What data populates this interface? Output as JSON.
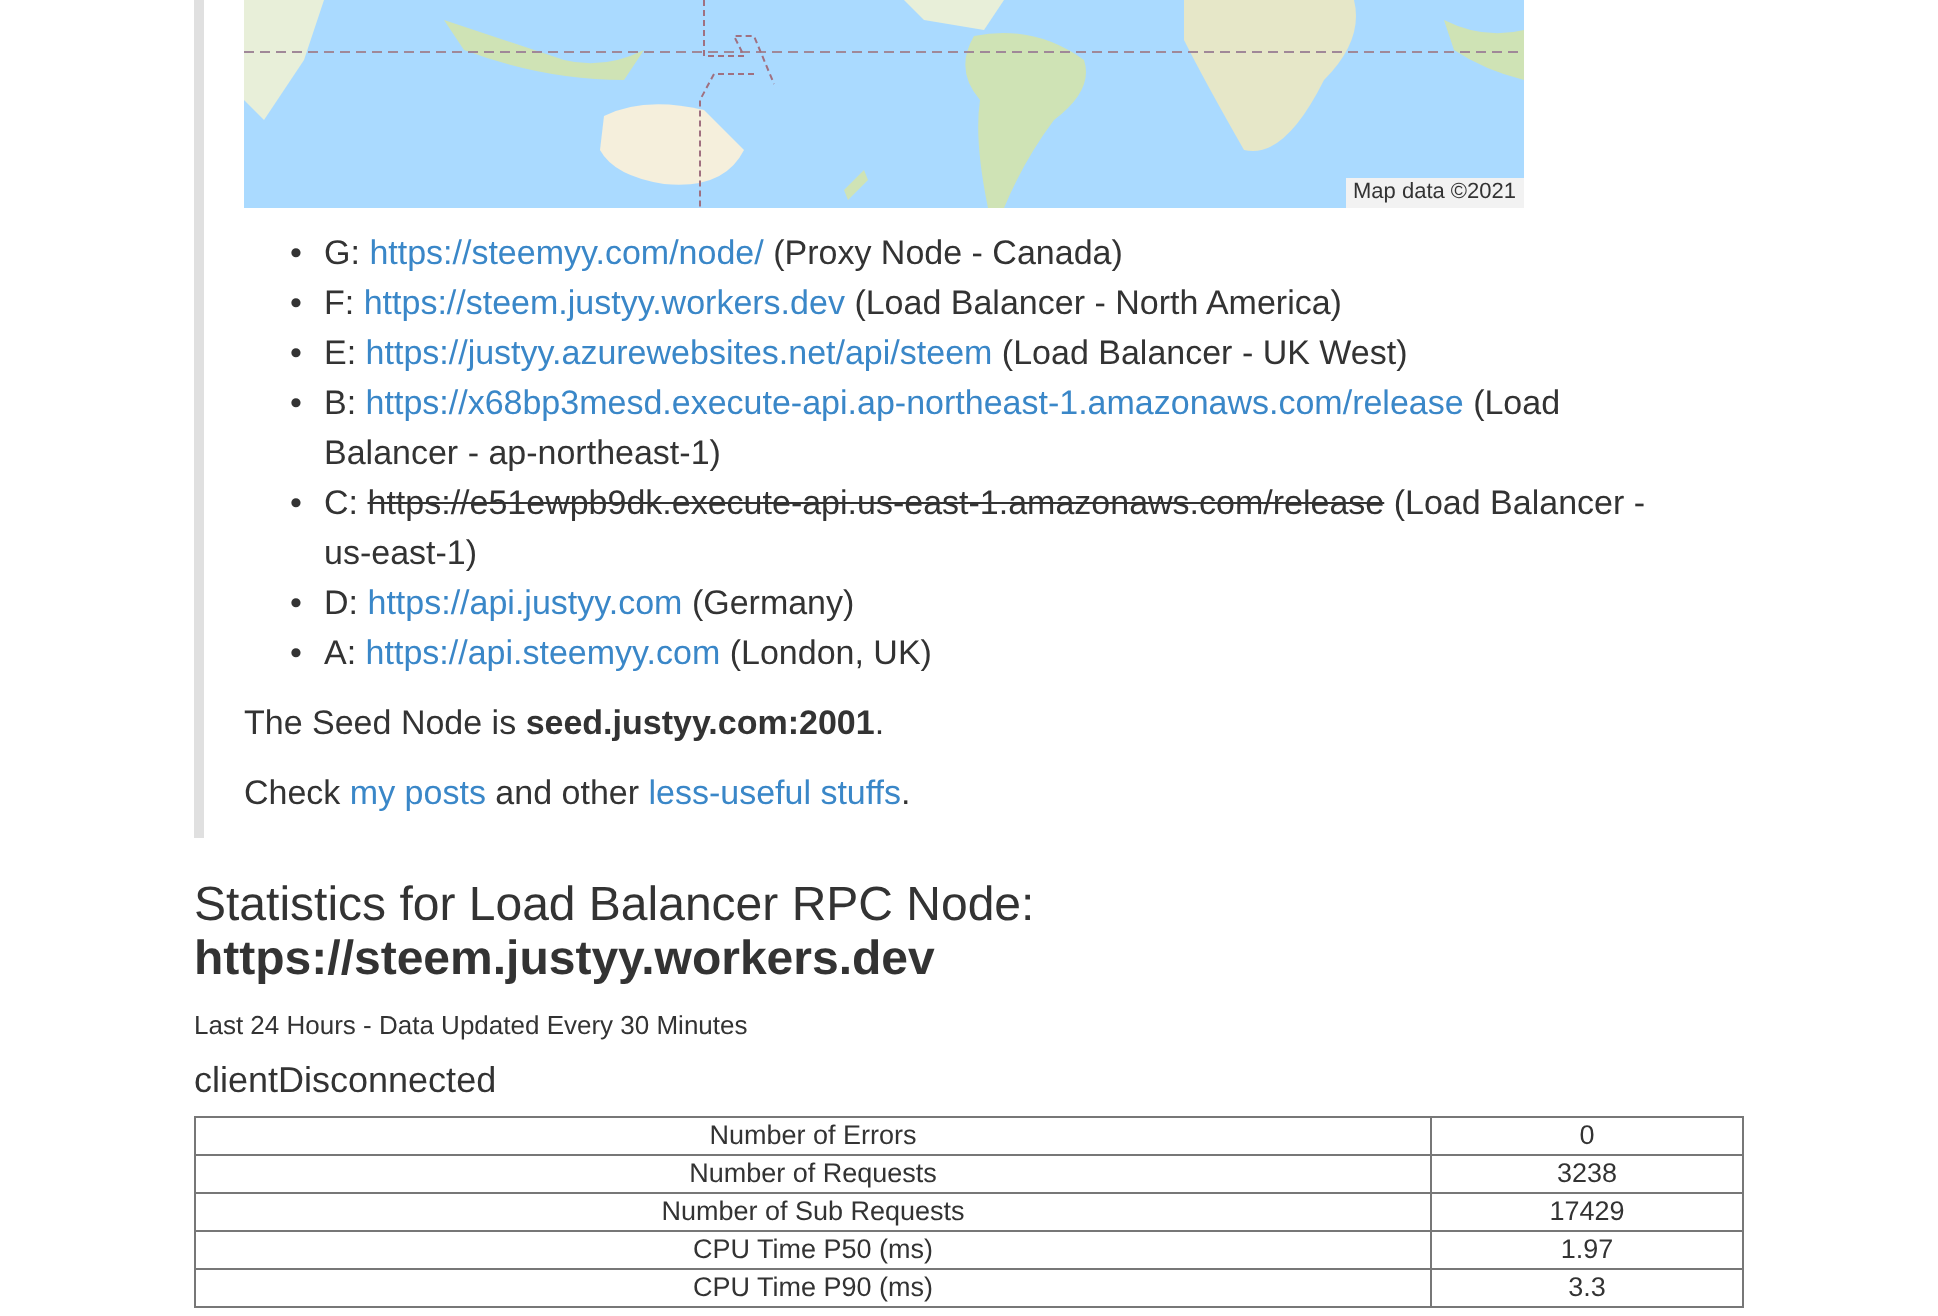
{
  "map": {
    "attribution": "Map data ©2021"
  },
  "nodes": [
    {
      "marker": "•",
      "prefix": "G:",
      "url": "https://steemyy.com/node/",
      "note": "(Proxy Node - Canada)",
      "struck": false
    },
    {
      "marker": "•",
      "prefix": "F:",
      "url": "https://steem.justyy.workers.dev",
      "note": "(Load Balancer - North America)",
      "struck": false
    },
    {
      "marker": "•",
      "prefix": "E:",
      "url": "https://justyy.azurewebsites.net/api/steem",
      "note": "(Load Balancer - UK West)",
      "struck": false
    },
    {
      "marker": "•",
      "prefix": "B:",
      "url": "https://x68bp3mesd.execute-api.ap-northeast-1.amazonaws.com/release",
      "note": "(Load Balancer - ap-northeast-1)",
      "struck": false
    },
    {
      "marker": "•",
      "prefix": "C:",
      "url": "https://e51ewpb9dk.execute-api.us-east-1.amazonaws.com/release",
      "note": "(Load Balancer - us-east-1)",
      "struck": true
    },
    {
      "marker": "•",
      "prefix": "D:",
      "url": "https://api.justyy.com",
      "note": "(Germany)",
      "struck": false
    },
    {
      "marker": "•",
      "prefix": "A:",
      "url": "https://api.steemyy.com",
      "note": "(London, UK)",
      "struck": false
    }
  ],
  "seed": {
    "before": "The Seed Node is ",
    "value": "seed.justyy.com:2001",
    "after": "."
  },
  "check": {
    "before": "Check ",
    "link1": "my posts",
    "middle": " and other ",
    "link2": "less-useful stuffs",
    "after": "."
  },
  "heading": {
    "title": "Statistics for Load Balancer RPC Node:",
    "url": "https://steem.justyy.workers.dev"
  },
  "subtitle": "Last 24 Hours - Data Updated Every 30 Minutes",
  "status": "clientDisconnected",
  "table": {
    "rows": [
      [
        "Number of Errors",
        "0"
      ],
      [
        "Number of Requests",
        "3238"
      ],
      [
        "Number of Sub Requests",
        "17429"
      ],
      [
        "CPU Time P50 (ms)",
        "1.97"
      ],
      [
        "CPU Time P90 (ms)",
        "3.3"
      ]
    ]
  }
}
